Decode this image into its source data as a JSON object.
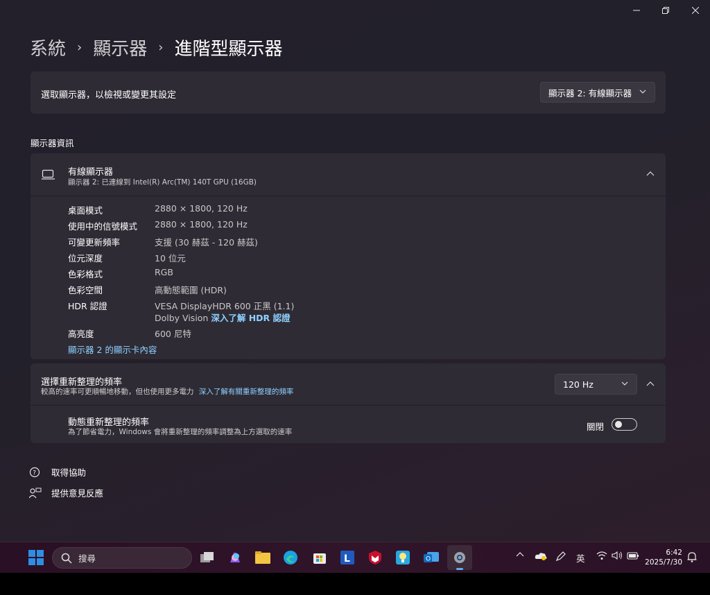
{
  "window": {
    "minimize_icon": "minimize-icon",
    "restore_icon": "restore-icon",
    "close_icon": "close-icon"
  },
  "breadcrumb": {
    "items": [
      "系統",
      "顯示器",
      "進階型顯示器"
    ],
    "separator": "›"
  },
  "select_display": {
    "label": "選取顯示器，以檢視或變更其設定",
    "value": "顯示器 2: 有線顯示器"
  },
  "display_info": {
    "section_title": "顯示器資訊",
    "title": "有線顯示器",
    "subtitle": "顯示器 2: 已連線到 Intel(R) Arc(TM) 140T GPU (16GB)",
    "rows": [
      {
        "key": "桌面模式",
        "value": "2880 × 1800, 120 Hz"
      },
      {
        "key": "使用中的信號模式",
        "value": "2880 × 1800, 120 Hz"
      },
      {
        "key": "可變更新頻率",
        "value": "支援 (30 赫茲 - 120 赫茲)"
      },
      {
        "key": "位元深度",
        "value": "10 位元"
      },
      {
        "key": "色彩格式",
        "value": "RGB"
      },
      {
        "key": "色彩空間",
        "value": "高動態範圍 (HDR)"
      },
      {
        "key": "HDR 認證",
        "value": "VESA DisplayHDR 600 正黑 (1.1)",
        "value2": "Dolby Vision",
        "link": "深入了解 HDR 認證"
      },
      {
        "key": "高亮度",
        "value": "600 尼特"
      }
    ],
    "adapter_link": "顯示器 2 的顯示卡內容"
  },
  "refresh_rate": {
    "title": "選擇重新整理的頻率",
    "subtitle": "較高的速率可更順暢地移動，但也使用更多電力",
    "link": "深入了解有關重新整理的頻率",
    "value": "120 Hz",
    "dynamic_title": "動態重新整理的頻率",
    "dynamic_subtitle": "為了節省電力，Windows 會將重新整理的頻率調整為上方選取的速率",
    "dynamic_state": "關閉"
  },
  "help": {
    "get_help": "取得協助",
    "feedback": "提供意見反應"
  },
  "taskbar": {
    "search_placeholder": "搜尋",
    "ime": "英",
    "time": "6:42",
    "date": "2025/7/30",
    "colors": {
      "start": "#2f8de4",
      "edge": "#1ba1e2",
      "folder": "#f4c542",
      "mcafee": "#c8102e",
      "lenovo": "#1f5bbf"
    }
  }
}
